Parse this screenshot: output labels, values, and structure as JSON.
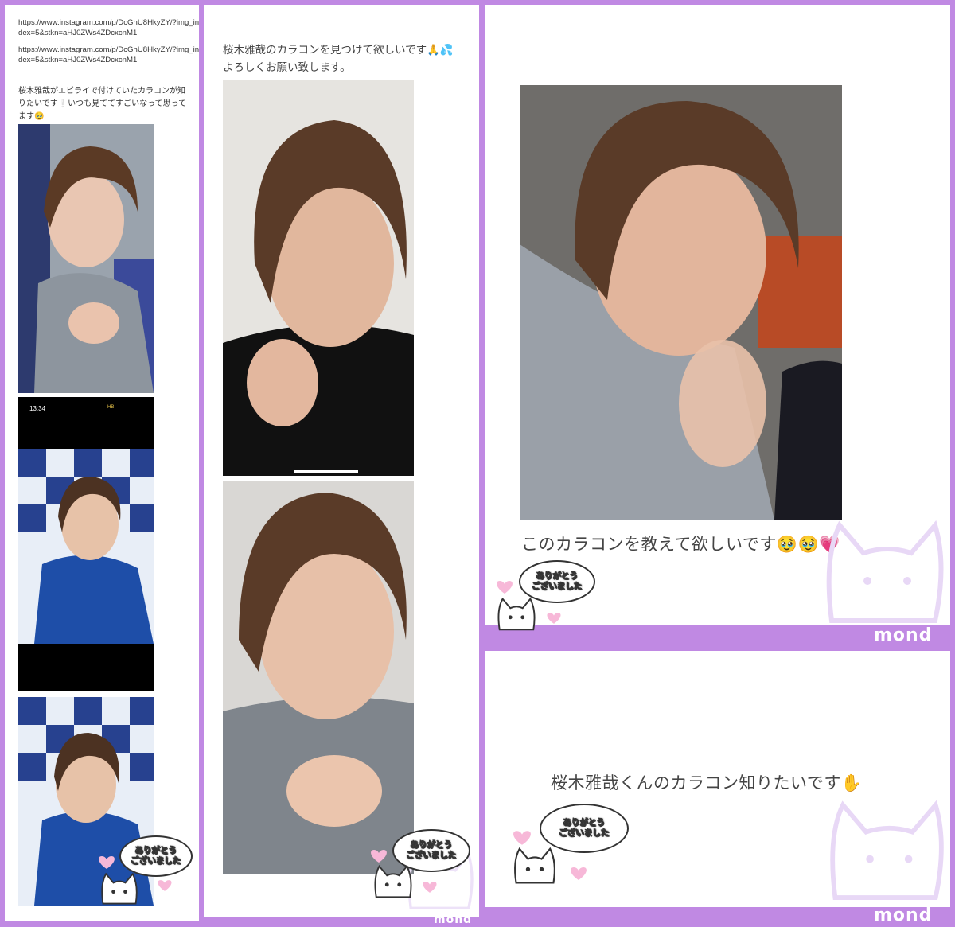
{
  "panel1": {
    "url_line1": "https://www.instagram.com/p/DcGhU8HkyZY/?img_index=5&stkn=aHJ0ZWs4ZDcxcnM1",
    "url_line2": "https://www.instagram.com/p/DcGhU8HkyZY/?img_index=5&stkn=aHJ0ZWs4ZDcxcnM1",
    "request": "桜木雅哉がエビライで付けていたカラコンが知りたいです❕いつも見ててすごいなって思ってます🥹",
    "phone_time": "13:34",
    "phone_status": "HB"
  },
  "panel2": {
    "request": "桜木雅哉のカラコンを見つけて欲しいです🙏💦よろしくお願い致します。"
  },
  "panel3": {
    "request": "このカラコンを教えて欲しいです🥹🥹💗"
  },
  "panel4": {
    "request": "桜木雅哉くんのカラコン知りたいです✋"
  },
  "stamp": {
    "thanks_text": "ありがとう\nございました"
  },
  "brand": {
    "name": "mond"
  },
  "colors": {
    "frame": "#c089e3",
    "panel": "#ffffff",
    "text": "#444444"
  }
}
